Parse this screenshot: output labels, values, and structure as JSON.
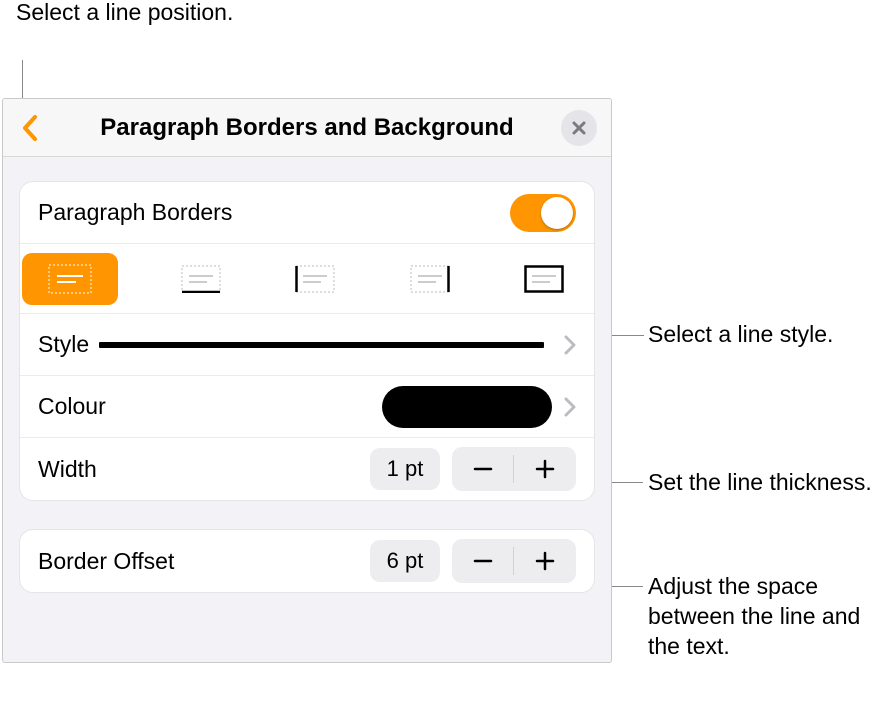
{
  "callouts": {
    "position": "Select a line position.",
    "style": "Select a line style.",
    "thickness": "Set the line thickness.",
    "offset": "Adjust the space between the line and the text."
  },
  "panel": {
    "title": "Paragraph Borders and Background",
    "borders_toggle_label": "Paragraph Borders",
    "borders_on": true,
    "style_label": "Style",
    "colour_label": "Colour",
    "colour_value": "#000000",
    "width_label": "Width",
    "width_value": "1 pt",
    "offset_label": "Border Offset",
    "offset_value": "6 pt",
    "positions": [
      {
        "id": "none",
        "selected": true
      },
      {
        "id": "bottom",
        "selected": false
      },
      {
        "id": "left",
        "selected": false
      },
      {
        "id": "right",
        "selected": false
      },
      {
        "id": "box",
        "selected": false
      }
    ]
  }
}
